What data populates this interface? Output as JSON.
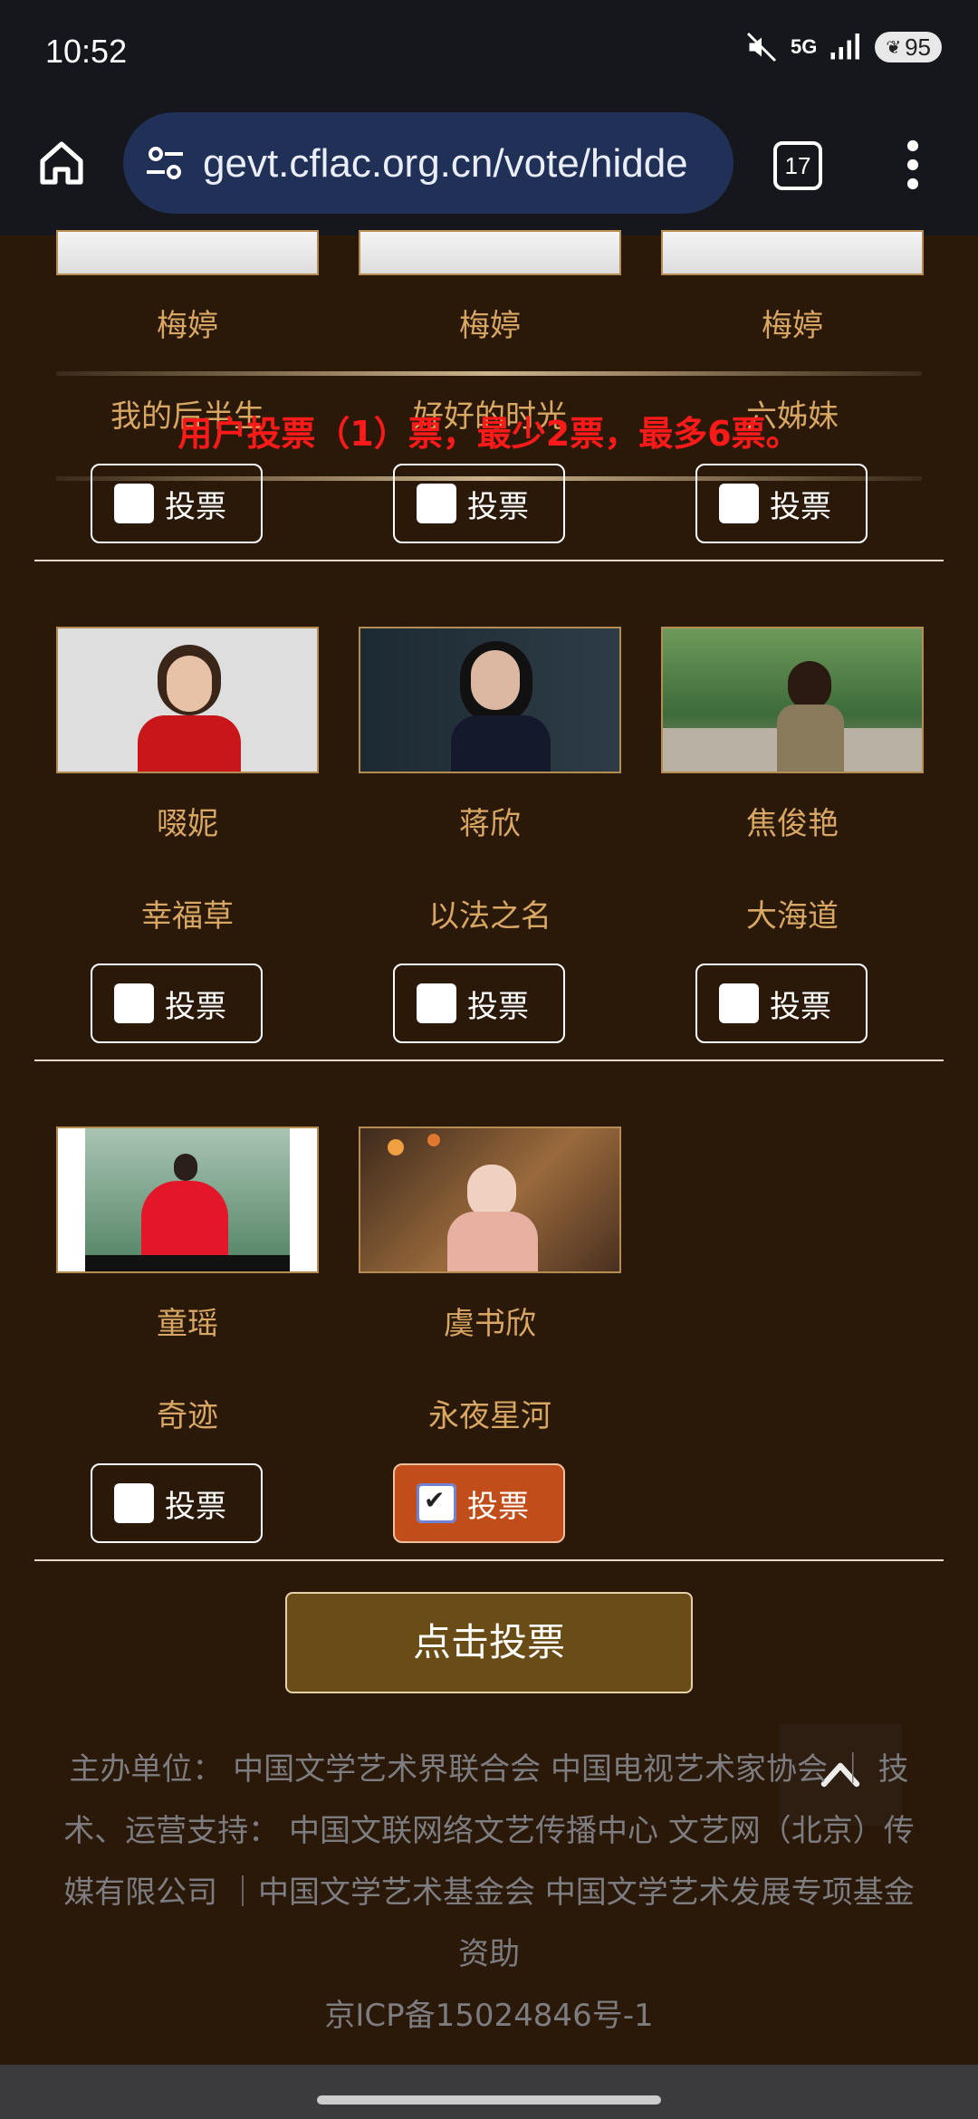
{
  "status": {
    "time": "10:52",
    "network": "5G",
    "battery": "95"
  },
  "browser": {
    "url": "gevt.cflac.org.cn/vote/hidde",
    "tab_count": "17"
  },
  "overlay_notice": "用户投票（1）票，最少2票，最多6票。",
  "vote_label": "投票",
  "rows": [
    [
      {
        "name": "梅婷",
        "work": "我的后半生"
      },
      {
        "name": "梅婷",
        "work": "好好的时光"
      },
      {
        "name": "梅婷",
        "work": "六姊妹"
      }
    ],
    [
      {
        "name": "啜妮",
        "work": "幸福草"
      },
      {
        "name": "蒋欣",
        "work": "以法之名"
      },
      {
        "name": "焦俊艳",
        "work": "大海道"
      }
    ],
    [
      {
        "name": "童瑶",
        "work": "奇迹"
      },
      {
        "name": "虞书欣",
        "work": "永夜星河",
        "checked": true
      }
    ]
  ],
  "submit_label": "点击投票",
  "footer": {
    "text1": "主办单位： 中国文学艺术界联合会 中国电视艺术家协会 ｜ 技术、运营支持： 中国文联网络文艺传播中心 文艺网（北京）传媒有限公司 ｜中国文学艺术基金会 中国文学艺术发展专项基金资助",
    "icp": "京ICP备15024846号-1"
  },
  "colors": {
    "accent_gold": "#d9a764",
    "overlay_red": "#ff1a1a",
    "checked_orange": "#c14e1a"
  }
}
